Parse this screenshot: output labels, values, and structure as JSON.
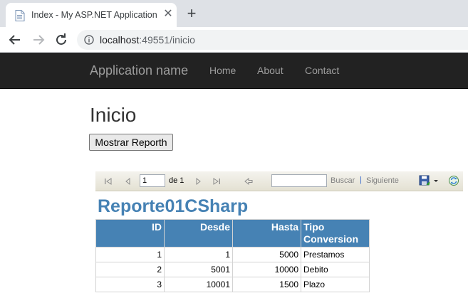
{
  "browser": {
    "tab_title": "Index - My ASP.NET Application",
    "close_glyph": "✕",
    "new_tab_glyph": "+",
    "url_host": "localhost",
    "url_rest": ":49551/inicio"
  },
  "navbar": {
    "brand": "Application name",
    "links": [
      {
        "label": "Home"
      },
      {
        "label": "About"
      },
      {
        "label": "Contact"
      }
    ]
  },
  "page": {
    "title": "Inicio",
    "button_label": "Mostrar Reporth"
  },
  "report_toolbar": {
    "page_value": "1",
    "of_text": "de 1",
    "find_label": "Buscar",
    "separator": "|",
    "next_label": "Siguiente"
  },
  "report": {
    "title": "Reporte01CSharp",
    "headers": [
      "ID",
      "Desde",
      "Hasta",
      "Tipo Conversion"
    ],
    "rows": [
      [
        "1",
        "1",
        "5000",
        "Prestamos"
      ],
      [
        "2",
        "5001",
        "10000",
        "Debito"
      ],
      [
        "3",
        "10001",
        "1500",
        "Plazo"
      ]
    ]
  },
  "colors": {
    "navbar_bg": "#222222",
    "report_accent": "#4682b4",
    "link_blue": "#3366cc"
  }
}
